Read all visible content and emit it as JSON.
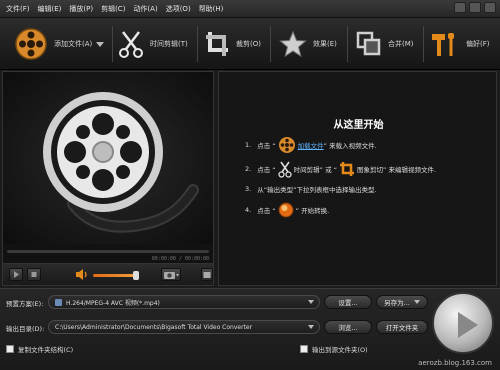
{
  "menu": [
    "文件(F)",
    "编辑(E)",
    "播放(P)",
    "剪辑(C)",
    "动作(A)",
    "选项(O)",
    "帮助(H)"
  ],
  "toolbar": {
    "add_file": "添加文件(A)",
    "trim": "时间剪辑(T)",
    "crop": "裁剪(O)",
    "effect": "效果(E)",
    "merge": "合并(M)",
    "preferences": "偏好(F)"
  },
  "player": {
    "timecode": "00:00:00 / 00:00:00",
    "volume_level": 0.85
  },
  "start": {
    "title": "从这里开始",
    "step1_num": "1.",
    "step1_pre": "点击 “",
    "step1_link": "加载文件",
    "step1_post": "” 来载入视频文件.",
    "step2_num": "2.",
    "step2_pre": "点击 “",
    "step2_mid1": "时间剪辑",
    "step2_mid2": "” 或 “",
    "step2_mid3": "图象剪切",
    "step2_post": "” 来编辑视频文件.",
    "step3_num": "3.",
    "step3_text": "从“输出类型”下拉列表框中选择输出类型.",
    "step4_num": "4.",
    "step4_pre": "点击 “",
    "step4_post": "” 开始转换."
  },
  "bottom": {
    "profile_label": "预置方案(E):",
    "profile_value": "H.264/MPEG-4 AVC 视频(*.mp4)",
    "settings_button": "设置...",
    "save_as_button": "另存为...",
    "output_label": "输出目录(D):",
    "output_value": "C:\\Users\\Administrator\\Documents\\Bigasoft Total Video Converter",
    "browse_button": "浏览...",
    "open_folder_button": "打开文件夹",
    "copy_structure_label": "复制文件夹结构(C)",
    "output_to_source_label": "输出到源文件夹(O)",
    "watermark": "aerozb.blog.163.com"
  },
  "colors": {
    "accent": "#e36a12",
    "link": "#5fb3ff"
  }
}
